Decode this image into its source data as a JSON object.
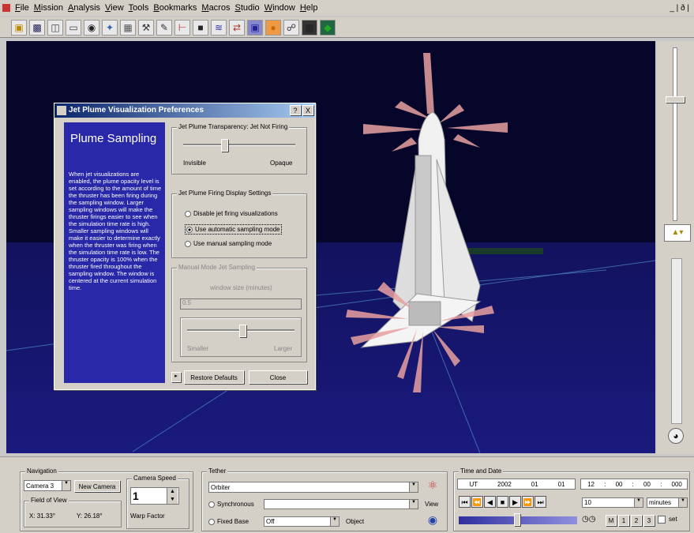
{
  "menu": [
    "File",
    "Mission",
    "Analysis",
    "View",
    "Tools",
    "Bookmarks",
    "Macros",
    "Studio",
    "Window",
    "Help"
  ],
  "window_controls": "_ | ð |",
  "toolbar_icons": [
    "open-icon",
    "save-icon",
    "print-icon",
    "copy-icon",
    "camera-icon",
    "satellite-icon",
    "grid-icon",
    "tool-icon",
    "pen-icon",
    "axis-icon",
    "chart-icon",
    "graph-icon",
    "plot-icon",
    "monitor-icon",
    "globe-icon",
    "network-icon",
    "film-icon",
    "map-icon"
  ],
  "dialog": {
    "title": "Jet Plume Visualization Preferences",
    "help": "?",
    "close": "X",
    "panel_heading": "Plume Sampling",
    "panel_text": "When jet visualizations are enabled, the plume opacity level is set according to the amount of time the thruster has been firing during the sampling window. Larger sampling windows will make the thruster firings easier to see when the simulation time rate is high. Smaller sampling windows will make it easier to determine exactly when the thruster was firing when the simulation time rate is low. The thruster opacity is 100% when the thruster fired throughout the sampling window. The window is centered at the current simulation time.",
    "transparency_group": "Jet Plume Transparency: Jet Not Firing",
    "trans_min": "Invisible",
    "trans_max": "Opaque",
    "firing_group": "Jet Plume Firing Display Settings",
    "radio1": "Disable jet firing visualizations",
    "radio2": "Use automatic sampling mode",
    "radio3": "Use manual sampling mode",
    "manual_group": "Manual Mode Jet Sampling",
    "window_size_label": "window size (minutes)",
    "window_size_value": "0.5",
    "size_min": "Smaller",
    "size_max": "Larger",
    "restore_button": "Restore Defaults",
    "close_button": "Close",
    "transparency_level": 0.4,
    "size_level": 0.55
  },
  "navigation": {
    "title": "Navigation",
    "camera": "Camera 3",
    "new_camera": "New Camera",
    "fov_label": "Field of View",
    "fov_x": "X: 31.33°",
    "fov_y": "Y: 26.18°",
    "speed_label": "Camera Speed",
    "speed_value": "1",
    "warp": "Warp Factor"
  },
  "tether": {
    "title": "Tether",
    "field": "Orbiter",
    "synchronous": "Synchronous",
    "view": "View",
    "fixed_base": "Fixed Base",
    "fixed_value": "Off",
    "object": "Object"
  },
  "time": {
    "title": "Time and Date",
    "tz": "UT",
    "year": "2002",
    "month": "01",
    "day": "01",
    "hh": "12",
    "mm": "00",
    "ss": "00",
    "ms": "000",
    "sep": ":",
    "step_value": "10",
    "unit": "minutes",
    "btn1": "M",
    "btn2": "1",
    "btn3": "2",
    "btn4": "3",
    "set": "set",
    "slider_level": 0.5
  },
  "colors": {
    "space": "#06062a",
    "ground": "#1a1a7e",
    "dialog_panel": "#2828a8",
    "plume": "#e8a0a0"
  }
}
